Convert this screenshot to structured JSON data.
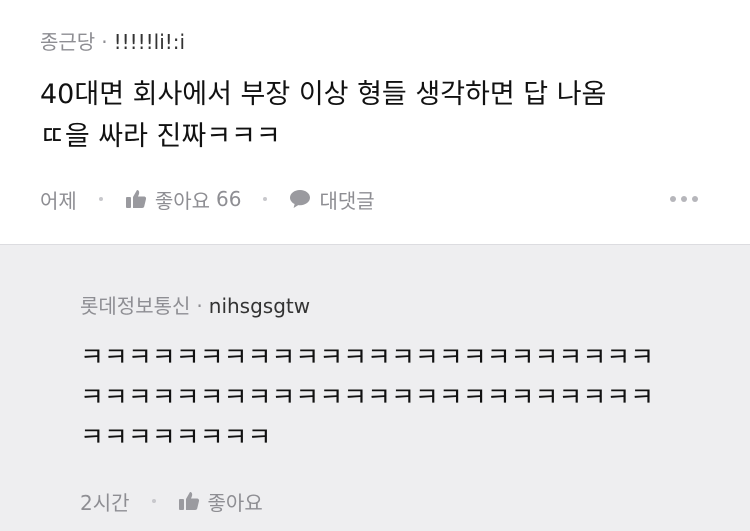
{
  "post": {
    "author": "종근당",
    "username": "!!!!!li!:i",
    "body_line1": "40대면 회사에서 부장 이상 형들 생각하면 답 나옴",
    "body_line2": "ㄸ을 싸라 진짜ㅋㅋㅋ",
    "time": "어제",
    "like_label": "좋아요",
    "like_count": "66",
    "reply_label": "대댓글",
    "icons": [
      "thumbs-up-icon",
      "speech-bubble-icon",
      "more-dots-icon"
    ]
  },
  "reply": {
    "author": "롯데정보통신",
    "username": "nihsgsgtw",
    "line1": "ㅋㅋㅋㅋㅋㅋㅋㅋㅋㅋㅋㅋㅋㅋㅋㅋㅋㅋㅋㅋㅋㅋㅋㅋ",
    "line2": "ㅋㅋㅋㅋㅋㅋㅋㅋㅋㅋㅋㅋㅋㅋㅋㅋㅋㅋㅋㅋㅋㅋㅋㅋ",
    "line3": "ㅋㅋㅋㅋㅋㅋㅋㅋ",
    "time": "2시간",
    "like_label": "좋아요"
  },
  "colors": {
    "muted": "#8e8e93",
    "reply_bg": "#eeeef0",
    "text": "#111111"
  }
}
